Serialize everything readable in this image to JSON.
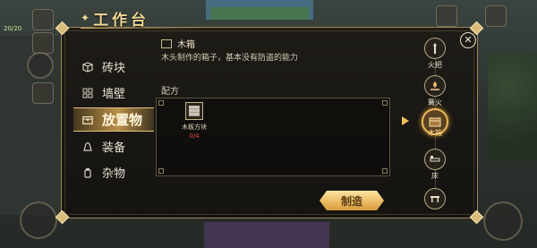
{
  "hud": {
    "hp_text": "20/20"
  },
  "panel": {
    "title": "工作台"
  },
  "categories": [
    {
      "label": "砖块",
      "icon": "cube-icon",
      "active": false
    },
    {
      "label": "墙壁",
      "icon": "wall-icon",
      "active": false
    },
    {
      "label": "放置物",
      "icon": "chest-icon",
      "active": true
    },
    {
      "label": "装备",
      "icon": "bell-icon",
      "active": false
    },
    {
      "label": "杂物",
      "icon": "jar-icon",
      "active": false
    }
  ],
  "detail": {
    "name": "木箱",
    "description": "木头制作的箱子，基本没有防盗的能力",
    "recipe_label": "配方",
    "ingredient": {
      "name": "木板方块",
      "count": "0/4"
    }
  },
  "right_items": [
    {
      "label": "火把",
      "icon": "torch-icon"
    },
    {
      "label": "篝火",
      "icon": "campfire-icon"
    },
    {
      "label": "木箱",
      "icon": "chest-icon",
      "active": true
    },
    {
      "label": "床",
      "icon": "bed-icon"
    },
    {
      "label": "",
      "icon": "table-icon"
    }
  ],
  "buttons": {
    "craft": "制造",
    "close": "✕"
  },
  "colors": {
    "accent": "#e8b75a",
    "panel_border": "#9c8554",
    "missing": "#e2433a"
  }
}
